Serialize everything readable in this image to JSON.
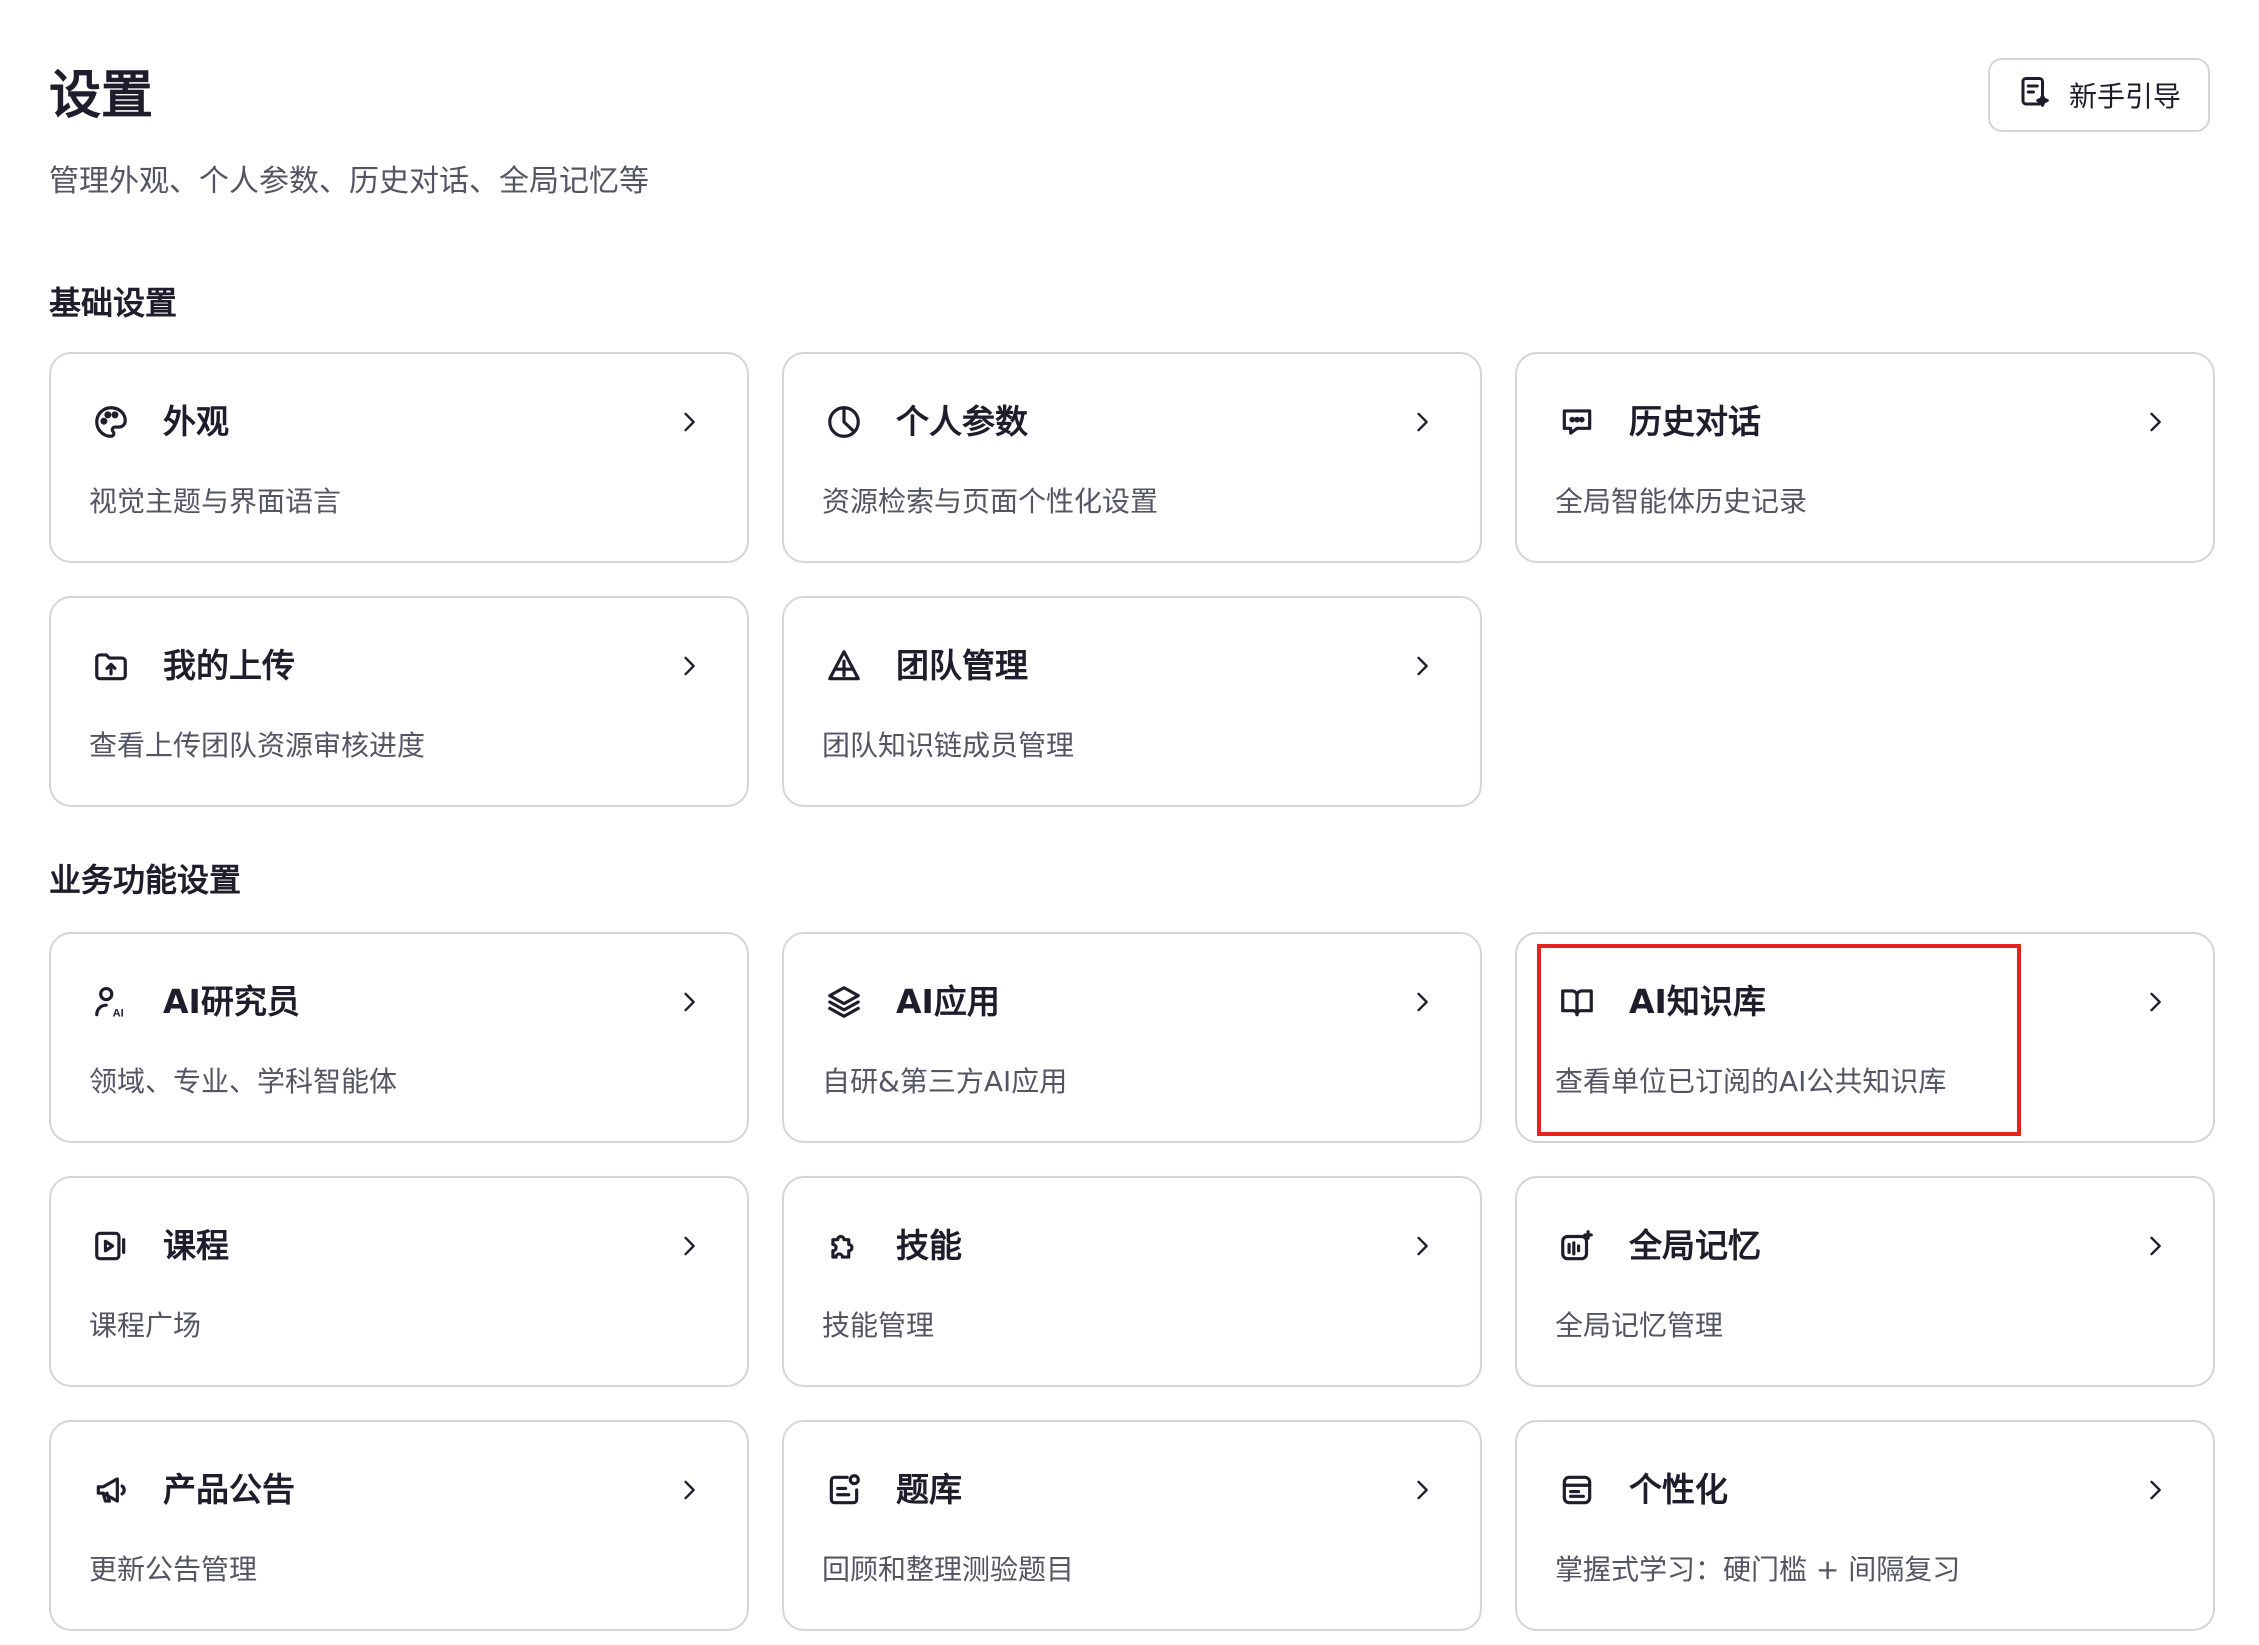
{
  "header": {
    "title": "设置",
    "subtitle": "管理外观、个人参数、历史对话、全局记忆等",
    "guide_button": "新手引导"
  },
  "sections": [
    {
      "title": "基础设置",
      "cards": [
        {
          "title": "外观",
          "desc": "视觉主题与界面语言",
          "icon": "palette-icon"
        },
        {
          "title": "个人参数",
          "desc": "资源检索与页面个性化设置",
          "icon": "pie-chart-icon"
        },
        {
          "title": "历史对话",
          "desc": "全局智能体历史记录",
          "icon": "chat-history-icon"
        },
        {
          "title": "我的上传",
          "desc": "查看上传团队资源审核进度",
          "icon": "upload-folder-icon"
        },
        {
          "title": "团队管理",
          "desc": "团队知识链成员管理",
          "icon": "team-icon"
        }
      ]
    },
    {
      "title": "业务功能设置",
      "cards": [
        {
          "title": "AI研究员",
          "desc": "领域、专业、学科智能体",
          "icon": "ai-researcher-icon"
        },
        {
          "title": "AI应用",
          "desc": "自研&第三方AI应用",
          "icon": "layers-icon"
        },
        {
          "title": "AI知识库",
          "desc": "查看单位已订阅的AI公共知识库",
          "icon": "book-icon"
        },
        {
          "title": "课程",
          "desc": "课程广场",
          "icon": "course-icon"
        },
        {
          "title": "技能",
          "desc": "技能管理",
          "icon": "puzzle-icon"
        },
        {
          "title": "全局记忆",
          "desc": "全局记忆管理",
          "icon": "memory-icon"
        },
        {
          "title": "产品公告",
          "desc": "更新公告管理",
          "icon": "megaphone-icon"
        },
        {
          "title": "题库",
          "desc": "回顾和整理测验题目",
          "icon": "question-bank-icon"
        },
        {
          "title": "个性化",
          "desc": "掌握式学习：硬门槛 + 间隔复习",
          "icon": "personalize-icon"
        }
      ]
    }
  ],
  "highlight_color": "#e8231f"
}
